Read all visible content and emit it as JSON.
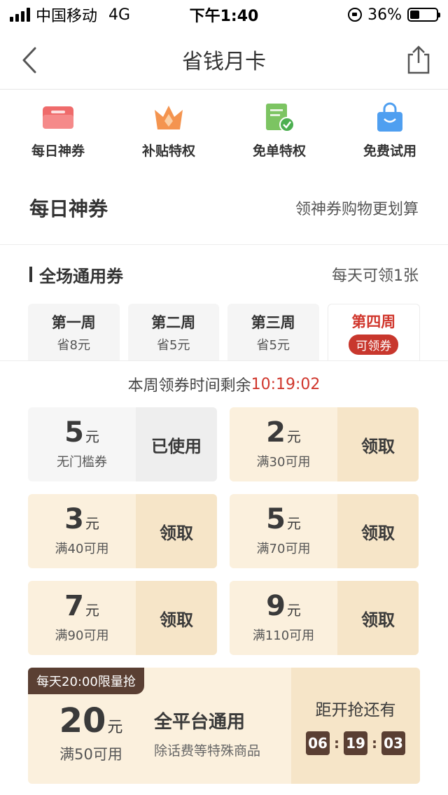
{
  "status_bar": {
    "carrier": "中国移动",
    "network": "4G",
    "time": "下午1:40",
    "battery_percent": "36%",
    "battery_level": 0.36
  },
  "nav": {
    "title": "省钱月卡",
    "back_icon": "chevron-left-icon",
    "share_icon": "share-icon"
  },
  "quick_nav": [
    {
      "label": "每日神券",
      "icon": "red-coupon-icon",
      "color": "#ef6b6b"
    },
    {
      "label": "补贴特权",
      "icon": "orange-crown-icon",
      "color": "#f4944f"
    },
    {
      "label": "免单特权",
      "icon": "green-document-check-icon",
      "color": "#7cc462"
    },
    {
      "label": "免费试用",
      "icon": "blue-shopping-bag-icon",
      "color": "#4f9ff0"
    }
  ],
  "daily_section": {
    "title": "每日神券",
    "subtitle": "领神券购物更划算"
  },
  "general_section": {
    "title": "全场通用券",
    "note": "每天可领1张"
  },
  "weeks": [
    {
      "name": "第一周",
      "sub": "省8元"
    },
    {
      "name": "第二周",
      "sub": "省5元"
    },
    {
      "name": "第三周",
      "sub": "省5元"
    },
    {
      "name": "第四周",
      "badge": "可领券"
    }
  ],
  "countdown": {
    "label": "本周领券时间剩余",
    "value": "10:19:02"
  },
  "coupons": [
    {
      "amount": "5",
      "unit": "元",
      "condition": "无门槛券",
      "action": "已使用",
      "used": true
    },
    {
      "amount": "2",
      "unit": "元",
      "condition": "满30可用",
      "action": "领取",
      "used": false
    },
    {
      "amount": "3",
      "unit": "元",
      "condition": "满40可用",
      "action": "领取",
      "used": false
    },
    {
      "amount": "5",
      "unit": "元",
      "condition": "满70可用",
      "action": "领取",
      "used": false
    },
    {
      "amount": "7",
      "unit": "元",
      "condition": "满90可用",
      "action": "领取",
      "used": false
    },
    {
      "amount": "9",
      "unit": "元",
      "condition": "满110可用",
      "action": "领取",
      "used": false
    }
  ],
  "flash_sale": {
    "tag": "每天20:00限量抢",
    "amount": "20",
    "unit": "元",
    "condition": "满50可用",
    "title": "全平台通用",
    "description": "除话费等特殊商品",
    "timer_label": "距开抢还有",
    "hours": "06",
    "minutes": "19",
    "seconds": "03"
  }
}
